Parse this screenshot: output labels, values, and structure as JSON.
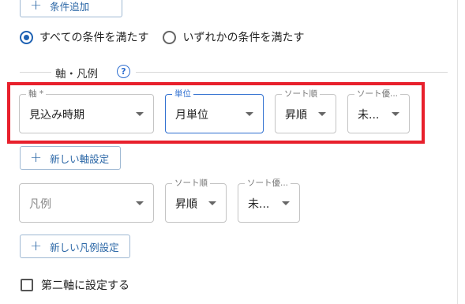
{
  "conditions": {
    "add_button": "条件追加",
    "match_all": "すべての条件を満たす",
    "match_any": "いずれかの条件を満たす",
    "selected": "match_all"
  },
  "axis_section": {
    "title": "軸・凡例",
    "help_icon": "question-circle-icon"
  },
  "axis_row": {
    "axis": {
      "label": "軸 *",
      "value": "見込み時期"
    },
    "unit": {
      "label": "単位",
      "value": "月単位"
    },
    "sort_order": {
      "label": "ソート順",
      "value": "昇順"
    },
    "sort_priority": {
      "label": "ソート優...",
      "value": "未..."
    }
  },
  "new_axis_button": "新しい軸設定",
  "legend_row": {
    "legend": {
      "placeholder": "凡例"
    },
    "sort_order": {
      "label": "ソート順",
      "value": "昇順"
    },
    "sort_priority": {
      "label": "ソート優...",
      "value": "未..."
    }
  },
  "new_legend_button": "新しい凡例設定",
  "second_axis": {
    "label": "第二軸に設定する",
    "checked": false
  },
  "colors": {
    "accent": "#1f62b3",
    "highlight": "#e8202c",
    "button_text": "#2a66a6"
  }
}
